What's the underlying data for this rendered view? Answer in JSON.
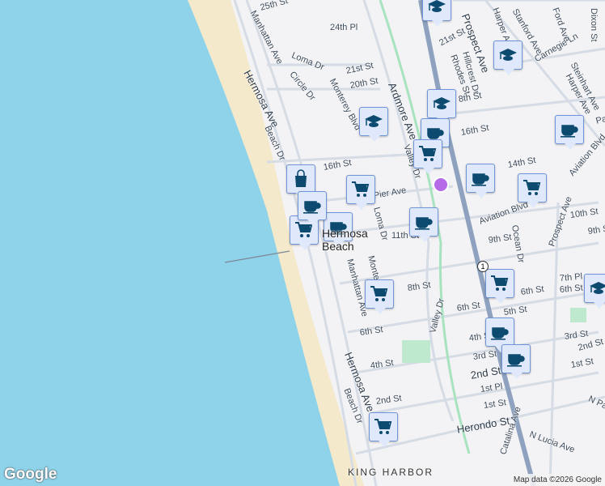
{
  "map": {
    "city_label": "Hermosa Beach",
    "city_label_line1": "Hermosa",
    "city_label_line2": "Beach",
    "area_label": "KING HARBOR",
    "highway_shield": "1",
    "attribution": "Map data ©2026 Google",
    "logo": "Google",
    "streets": [
      "25th St",
      "Manhattan Ave",
      "24th Pl",
      "Loma Dr",
      "Hermosa Ave",
      "Circle Dr",
      "Monterey Blvd",
      "21st St",
      "20th St",
      "Ardmore Ave",
      "21st St",
      "Rhodes St",
      "Hillcrest Dr",
      "Prospect Ave",
      "Harper Ave",
      "Stanford Ave",
      "Carnegie Ln",
      "Ford Ave",
      "Steinhart Ave",
      "Dixon St",
      "Harper Ave",
      "8th St",
      "16th St",
      "Beach Dr",
      "16th St",
      "Valley Dr",
      "Pier Ave",
      "14th St",
      "Palm",
      "Aviation Blvd",
      "Loma Dr",
      "11th St",
      "Aviation Blvd",
      "10th St",
      "9th St",
      "Prospect Ave",
      "Ocean Dr",
      "9th St",
      "Monterey",
      "Manhattan Ave",
      "8th St",
      "Valley Dr",
      "6th St",
      "7th Pl",
      "6th St",
      "6th St",
      "5th St",
      "3rd St",
      "4th St",
      "3rd St",
      "2nd St",
      "6th St",
      "4th St",
      "Hermosa Ave",
      "2nd St",
      "1st Pl",
      "1st St",
      "1st St",
      "Herondo St",
      "N Lucia Ave",
      "Beach Dr",
      "2nd St",
      "Catalina Ave",
      "N Pa"
    ],
    "markers": [
      {
        "type": "school"
      },
      {
        "type": "school"
      },
      {
        "type": "school"
      },
      {
        "type": "school"
      },
      {
        "type": "cup"
      },
      {
        "type": "cart"
      },
      {
        "type": "cup"
      },
      {
        "type": "bag"
      },
      {
        "type": "cart"
      },
      {
        "type": "cart"
      },
      {
        "type": "cup"
      },
      {
        "type": "cup"
      },
      {
        "type": "cart"
      },
      {
        "type": "cup"
      },
      {
        "type": "cup"
      },
      {
        "type": "cart"
      },
      {
        "type": "cart"
      },
      {
        "type": "school"
      },
      {
        "type": "cup"
      },
      {
        "type": "cup"
      },
      {
        "type": "cart"
      }
    ],
    "colors": {
      "water": "#8fd3ea",
      "beach": "#f5e9cb",
      "land": "#f3f2f4",
      "road": "#d5dce5",
      "highway": "#8ea2bf",
      "marker_icon": "#0d4a70"
    }
  }
}
